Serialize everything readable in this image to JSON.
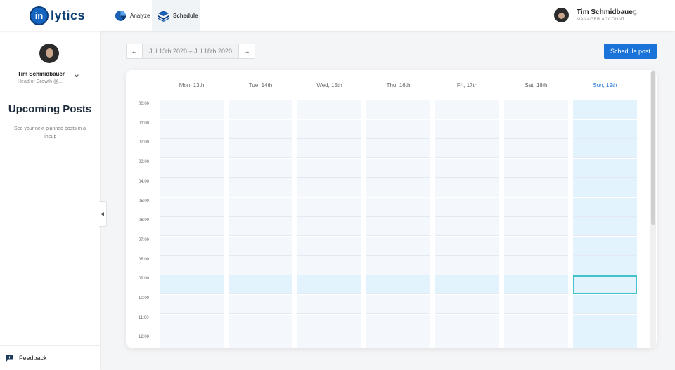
{
  "app": {
    "logo_mark": "in",
    "logo_text": "lytics"
  },
  "nav": {
    "analyze": {
      "label": "Analyze",
      "icon": "pie-chart-icon"
    },
    "schedule": {
      "label": "Schedule",
      "icon": "layers-icon"
    }
  },
  "user": {
    "name": "Tim Schmidbauer",
    "account_type": "MANAGER ACCOUNT",
    "role": "Head of Growth @..."
  },
  "sidebar": {
    "heading": "Upcoming Posts",
    "description": "See your next planned posts in a lineup",
    "feedback_label": "Feedback"
  },
  "toolbar": {
    "prev_label": "←",
    "next_label": "→",
    "date_range": "Jul 13th 2020 – Jul 18th 2020",
    "schedule_button": "Schedule post"
  },
  "calendar": {
    "days": [
      "Mon, 13th",
      "Tue, 14th",
      "Wed, 15th",
      "Thu, 16th",
      "Fri, 17th",
      "Sat, 18th",
      "Sun, 19th"
    ],
    "today_index": 6,
    "times": [
      "00:00",
      "01:00",
      "02:00",
      "03:00",
      "04:00",
      "05:00",
      "06:00",
      "07:00",
      "08:00",
      "09:00",
      "10:00",
      "11:00",
      "12:00"
    ],
    "highlighted_hour_index": 9,
    "selected_slot": {
      "day_index": 6,
      "hour_index": 9
    }
  },
  "colors": {
    "accent": "#1a73d9",
    "logo": "#0d3e74",
    "selected_border": "#41c2cc",
    "today_fill": "#e3f3fd"
  }
}
